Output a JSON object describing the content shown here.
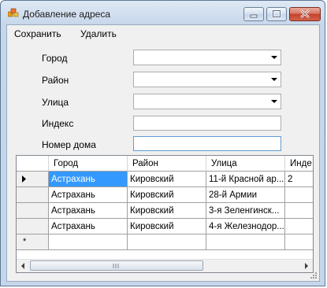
{
  "window": {
    "title": "Добавление адреса"
  },
  "menu": {
    "save": "Сохранить",
    "delete": "Удалить"
  },
  "form": {
    "city_label": "Город",
    "district_label": "Район",
    "street_label": "Улица",
    "index_label": "Индекс",
    "house_label": "Номер дома",
    "city_value": "",
    "district_value": "",
    "street_value": "",
    "index_value": "",
    "house_value": ""
  },
  "grid": {
    "columns": [
      "Город",
      "Район",
      "Улица",
      "Инде"
    ],
    "rows": [
      [
        "Астрахань",
        "Кировский",
        "11-й Красной ар...",
        "2"
      ],
      [
        "Астрахань",
        "Кировский",
        "28-й Армии",
        ""
      ],
      [
        "Астрахань",
        "Кировский",
        "3-я Зеленгинск...",
        ""
      ],
      [
        "Астрахань",
        "Кировский",
        "4-я Железнодор...",
        ""
      ]
    ],
    "new_row_marker": "*"
  }
}
